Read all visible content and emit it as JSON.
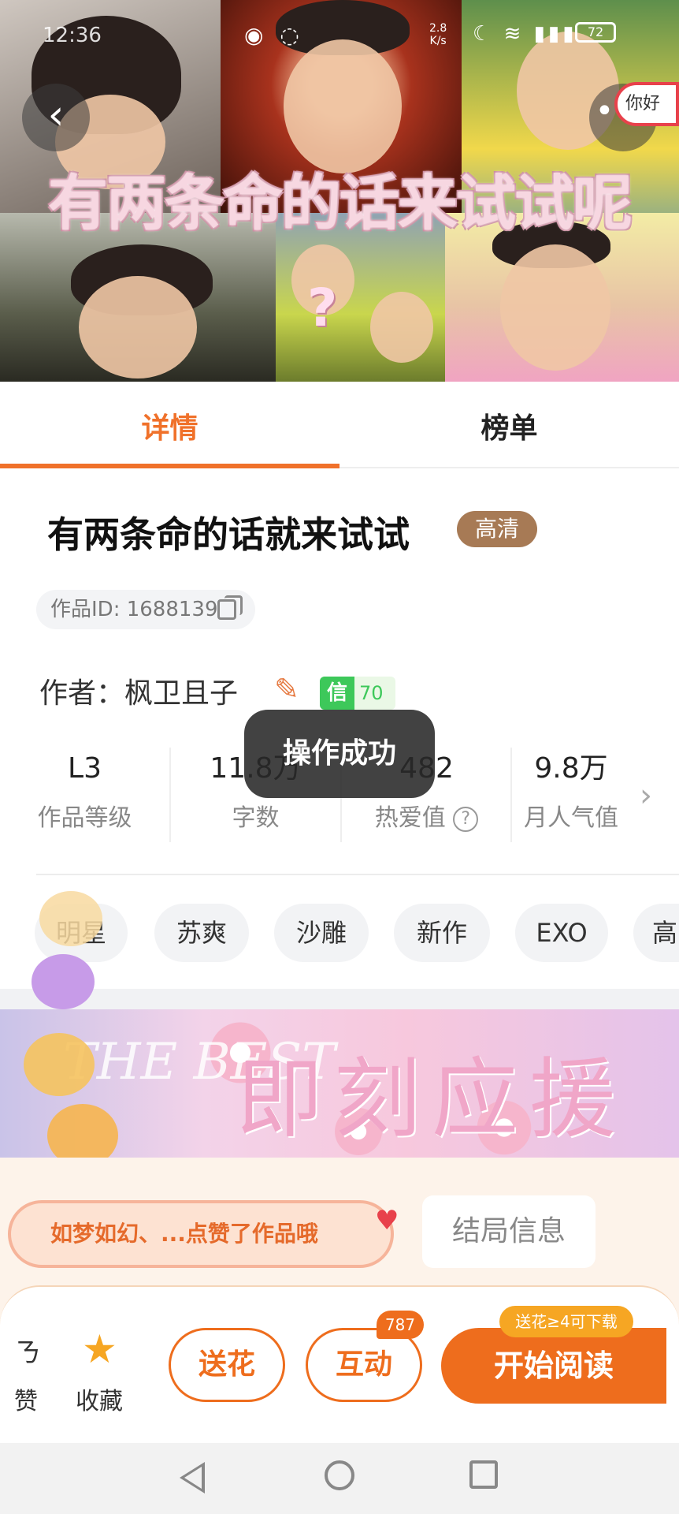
{
  "status_bar": {
    "time": "12:36",
    "net_speed": "2.8\nK/s",
    "battery": "72"
  },
  "cover": {
    "title": "有两条命的话来试试呢",
    "qmark": "?",
    "hello_text": "你好"
  },
  "tabs": [
    "详情",
    "榜单"
  ],
  "work": {
    "title": "有两条命的话就来试试",
    "badge": "高清",
    "id_text": "作品ID: 1688139",
    "author_text": "作者：枫卫且子",
    "trust_label": "信",
    "trust_score": "70"
  },
  "stats": [
    {
      "value": "L3",
      "label": "作品等级"
    },
    {
      "value": "11.8万",
      "label": "字数"
    },
    {
      "value": "482",
      "label": "热爱值"
    },
    {
      "value": "9.8万",
      "label": "月人气值"
    }
  ],
  "toast": "操作成功",
  "tags": [
    "明星",
    "苏爽",
    "沙雕",
    "新作",
    "EXO",
    "高"
  ],
  "banner": {
    "title": "即刻应援",
    "script_text": "THE BEST"
  },
  "activity": {
    "liked_message": "如梦如幻、...点赞了作品哦",
    "ending_button": "结局信息"
  },
  "action_bar": {
    "like_label": "赞",
    "favorite_label": "收藏",
    "flower_button": "送花",
    "interact_button": "互动",
    "interact_count": "787",
    "download_tip": "送花≥4可下载",
    "read_button": "开始阅读"
  },
  "colors": {
    "accent": "#ee6d1d",
    "badge_brown": "#a77a55",
    "trust_green": "#3dc85a",
    "fav_star": "#f6a623"
  }
}
